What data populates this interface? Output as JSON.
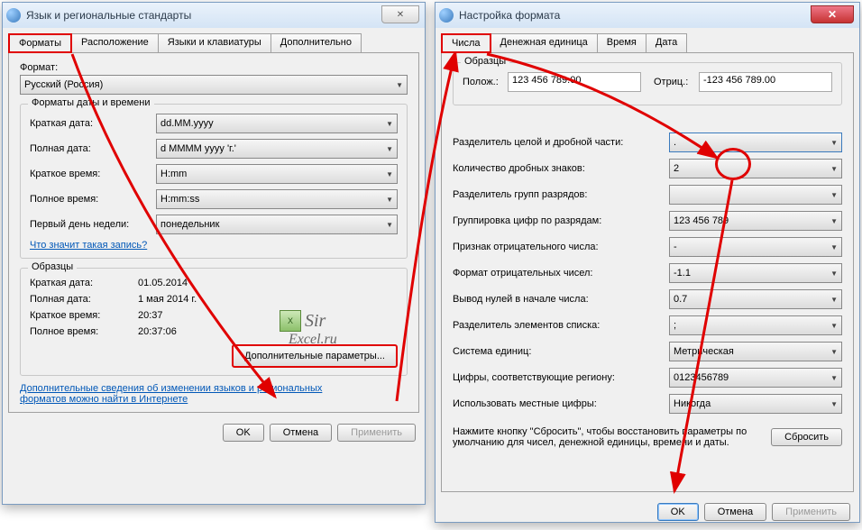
{
  "win1": {
    "title": "Язык и региональные стандарты",
    "tabs": [
      "Форматы",
      "Расположение",
      "Языки и клавиатуры",
      "Дополнительно"
    ],
    "format_label": "Формат:",
    "format_value": "Русский (Россия)",
    "dt_group": "Форматы даты и времени",
    "rows": [
      {
        "label": "Краткая дата:",
        "value": "dd.MM.yyyy"
      },
      {
        "label": "Полная дата:",
        "value": "d MMMM yyyy 'г.'"
      },
      {
        "label": "Краткое время:",
        "value": "H:mm"
      },
      {
        "label": "Полное время:",
        "value": "H:mm:ss"
      },
      {
        "label": "Первый день недели:",
        "value": "понедельник"
      }
    ],
    "notation_link": "Что значит такая запись?",
    "samples_group": "Образцы",
    "samples": [
      {
        "label": "Краткая дата:",
        "value": "01.05.2014"
      },
      {
        "label": "Полная дата:",
        "value": "1 мая 2014 г."
      },
      {
        "label": "Краткое время:",
        "value": "20:37"
      },
      {
        "label": "Полное время:",
        "value": "20:37:06"
      }
    ],
    "more_btn": "Дополнительные параметры...",
    "info_link": "Дополнительные сведения об изменении языков и региональных форматов можно найти в Интернете",
    "ok": "OK",
    "cancel": "Отмена",
    "apply": "Применить"
  },
  "win2": {
    "title": "Настройка формата",
    "tabs": [
      "Числа",
      "Денежная единица",
      "Время",
      "Дата"
    ],
    "samples_group": "Образцы",
    "pos_label": "Полож.:",
    "pos_value": "123 456 789.00",
    "neg_label": "Отриц.:",
    "neg_value": "-123 456 789.00",
    "rows": [
      {
        "label": "Разделитель целой и дробной части:",
        "value": "."
      },
      {
        "label": "Количество дробных знаков:",
        "value": "2"
      },
      {
        "label": "Разделитель групп разрядов:",
        "value": ""
      },
      {
        "label": "Группировка цифр по разрядам:",
        "value": "123 456 789"
      },
      {
        "label": "Признак отрицательного числа:",
        "value": "-"
      },
      {
        "label": "Формат отрицательных чисел:",
        "value": "-1.1"
      },
      {
        "label": "Вывод нулей в начале числа:",
        "value": "0.7"
      },
      {
        "label": "Разделитель элементов списка:",
        "value": ";"
      },
      {
        "label": "Система единиц:",
        "value": "Метрическая"
      },
      {
        "label": "Цифры, соответствующие региону:",
        "value": "0123456789"
      },
      {
        "label": "Использовать местные цифры:",
        "value": "Никогда"
      }
    ],
    "reset_hint": "Нажмите кнопку \"Сбросить\", чтобы восстановить параметры по умолчанию для чисел, денежной единицы, времени и даты.",
    "reset": "Сбросить",
    "ok": "OK",
    "cancel": "Отмена",
    "apply": "Применить"
  },
  "watermark": {
    "line1": "Sir",
    "line2": "Excel.ru"
  }
}
